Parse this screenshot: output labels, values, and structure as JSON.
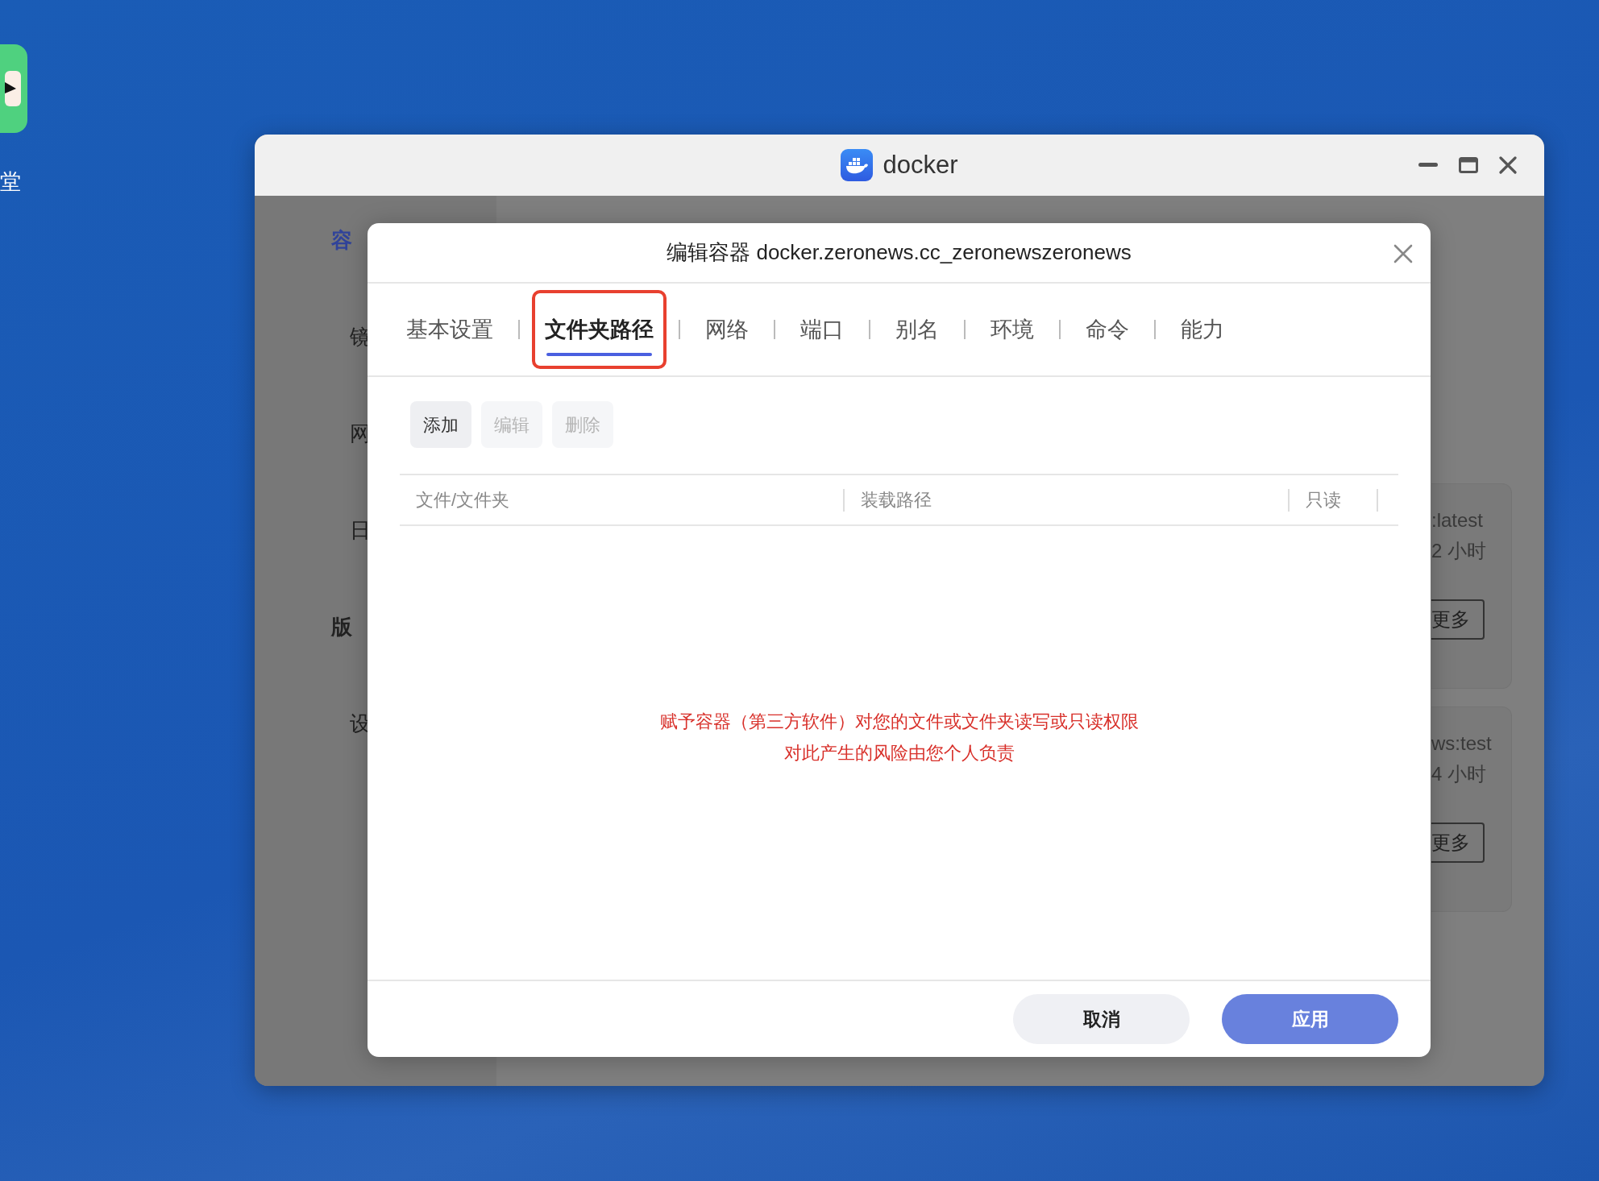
{
  "desktop": {
    "icon_label": "堂"
  },
  "window": {
    "title": "docker"
  },
  "sidebar": {
    "items": [
      {
        "label": "容",
        "kind": "header",
        "selected": true
      },
      {
        "label": "镜",
        "kind": "item",
        "selected": false
      },
      {
        "label": "网",
        "kind": "item",
        "selected": false
      },
      {
        "label": "日",
        "kind": "item",
        "selected": false
      },
      {
        "label": "版",
        "kind": "header",
        "selected": false
      },
      {
        "label": "设",
        "kind": "item",
        "selected": false
      }
    ]
  },
  "cards": [
    {
      "image": ":latest",
      "age": "2 小时",
      "button": "更多"
    },
    {
      "image": "ws:test",
      "age": "4 小时",
      "button": "更多"
    }
  ],
  "dialog": {
    "title": "编辑容器 docker.zeronews.cc_zeronewszeronews",
    "tabs": [
      {
        "label": "基本设置",
        "selected": false,
        "highlighted": false
      },
      {
        "label": "文件夹路径",
        "selected": true,
        "highlighted": true
      },
      {
        "label": "网络",
        "selected": false,
        "highlighted": false
      },
      {
        "label": "端口",
        "selected": false,
        "highlighted": false
      },
      {
        "label": "别名",
        "selected": false,
        "highlighted": false
      },
      {
        "label": "环境",
        "selected": false,
        "highlighted": false
      },
      {
        "label": "命令",
        "selected": false,
        "highlighted": false
      },
      {
        "label": "能力",
        "selected": false,
        "highlighted": false
      }
    ],
    "toolbar": [
      {
        "label": "添加",
        "disabled": false
      },
      {
        "label": "编辑",
        "disabled": true
      },
      {
        "label": "删除",
        "disabled": true
      }
    ],
    "table": {
      "columns": [
        "文件/文件夹",
        "装载路径",
        "只读"
      ]
    },
    "notice": [
      "赋予容器（第三方软件）对您的文件或文件夹读写或只读权限",
      "对此产生的风险由您个人负责"
    ],
    "buttons": [
      {
        "label": "取消",
        "kind": "secondary"
      },
      {
        "label": "应用",
        "kind": "primary"
      }
    ]
  }
}
